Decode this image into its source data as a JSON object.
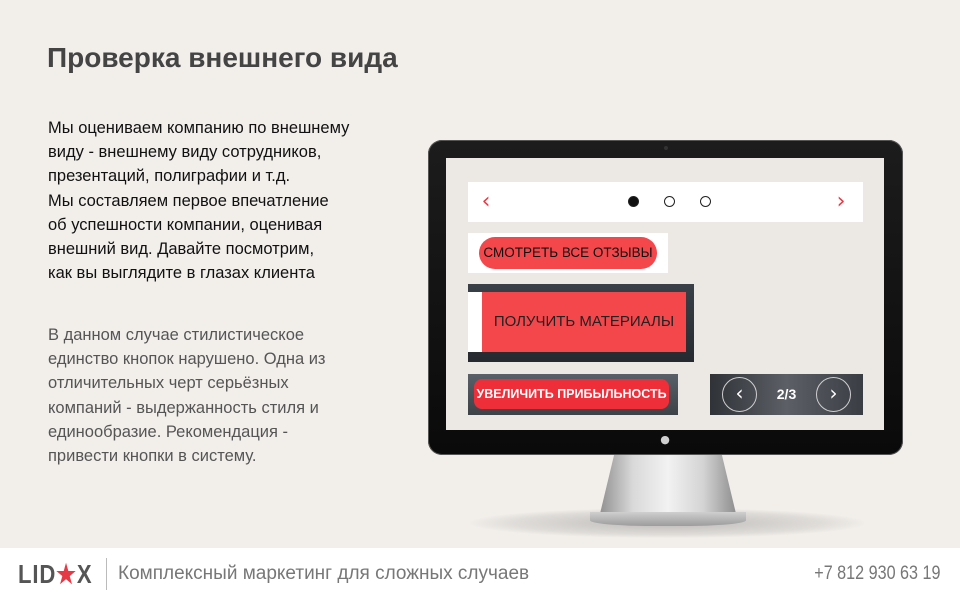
{
  "slide": {
    "title": "Проверка внешнего вида",
    "paragraph1": [
      "Мы оцениваем компанию по внешнему",
      "виду - внешнему виду сотрудников,",
      "презентаций, полиграфии и т.д.",
      "Мы составляем первое впечатление",
      "об успешности компании, оценивая",
      "внешний вид. Давайте посмотрим,",
      "как вы выглядите в глазах клиента"
    ],
    "paragraph2": [
      "В данном случае стилистическое",
      "единство кнопок нарушено. Одна из",
      "отличительных черт серьёзных",
      "компаний - выдержанность стиля и",
      "единообразие. Рекомендация -",
      "привести кнопки в систему."
    ]
  },
  "monitor_screen": {
    "slider": {
      "prev_icon": "chevron-left-icon",
      "next_icon": "chevron-right-icon",
      "dots": 3,
      "active_dot": 1
    },
    "button_reviews": "СМОТРЕТЬ ВСЕ ОТЗЫВЫ",
    "button_materials": "ПОЛУЧИТЬ МАТЕРИАЛЫ",
    "button_profit": "УВЕЛИЧИТЬ ПРИБЫЛЬНОСТЬ",
    "pager": {
      "counter": "2/3"
    }
  },
  "footer": {
    "logo_left": "LID",
    "logo_star": "★",
    "logo_right": "X",
    "tagline": "Комплексный маркетинг для сложных случаев",
    "phone": "+7 812 930 63 19"
  },
  "colors": {
    "background": "#f2efeb",
    "accent_red": "#f4474c",
    "brand_star": "#e63946"
  }
}
